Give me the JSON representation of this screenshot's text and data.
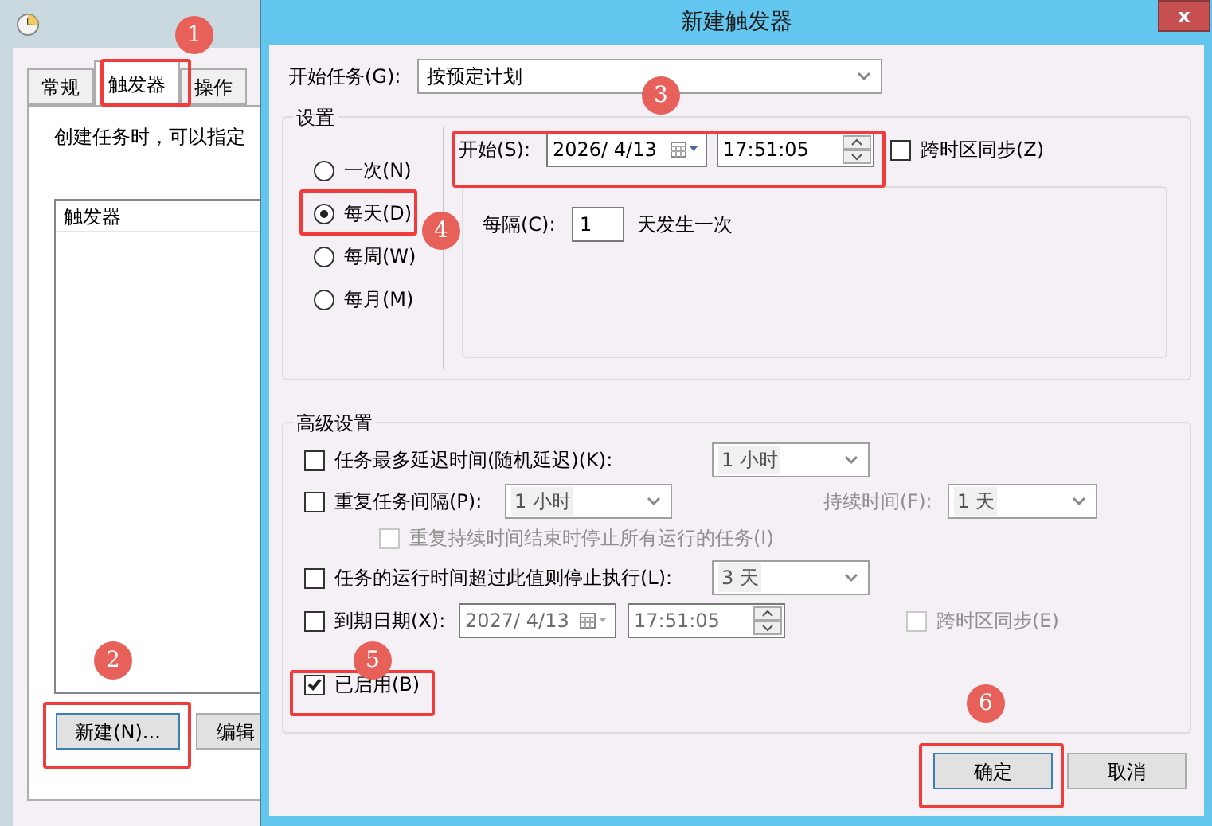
{
  "background_window": {
    "tabs": [
      {
        "label": "常规",
        "selected": false
      },
      {
        "label": "触发器",
        "selected": true
      },
      {
        "label": "操作",
        "selected": false
      }
    ],
    "description": "创建任务时，可以指定",
    "list_header": "触发器",
    "buttons": [
      {
        "label": "新建(N)...",
        "default": true
      },
      {
        "label": "编辑",
        "default": false
      }
    ]
  },
  "dialog": {
    "title": "新建触发器",
    "close": "x",
    "begin_task": {
      "label": "开始任务(G):",
      "value": "按预定计划"
    },
    "settings": {
      "title": "设置",
      "schedule": [
        {
          "label": "一次(N)",
          "selected": false
        },
        {
          "label": "每天(D)",
          "selected": true
        },
        {
          "label": "每周(W)",
          "selected": false
        },
        {
          "label": "每月(M)",
          "selected": false
        }
      ],
      "start": {
        "label": "开始(S):",
        "date": "2026/ 4/13",
        "time": "17:51:05"
      },
      "sync_timezone": {
        "label": "跨时区同步(Z)",
        "checked": false
      },
      "recur": {
        "label": "每隔(C):",
        "value": "1",
        "suffix": "天发生一次"
      }
    },
    "advanced": {
      "title": "高级设置",
      "delay": {
        "label": "任务最多延迟时间(随机延迟)(K):",
        "checked": false,
        "value": "1 小时"
      },
      "repeat": {
        "label": "重复任务间隔(P):",
        "checked": false,
        "value": "1 小时",
        "duration_label": "持续时间(F):",
        "duration_value": "1 天"
      },
      "stop_at_end": {
        "label": "重复持续时间结束时停止所有运行的任务(I)",
        "checked": false
      },
      "time_limit": {
        "label": "任务的运行时间超过此值则停止执行(L):",
        "checked": false,
        "value": "3 天"
      },
      "expire": {
        "label": "到期日期(X):",
        "checked": false,
        "date": "2027/ 4/13",
        "time": "17:51:05",
        "sync_label": "跨时区同步(E)",
        "sync_checked": false
      },
      "enabled": {
        "label": "已启用(B)",
        "checked": true
      }
    },
    "buttons": [
      {
        "label": "确定",
        "default": true
      },
      {
        "label": "取消",
        "default": false
      }
    ]
  },
  "annotations": [
    "1",
    "2",
    "3",
    "4",
    "5",
    "6"
  ]
}
